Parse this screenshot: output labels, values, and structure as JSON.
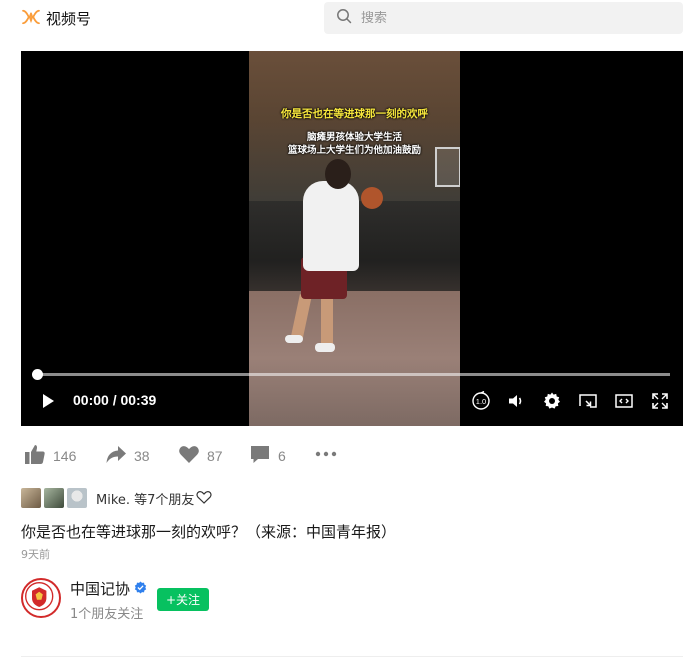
{
  "app": {
    "title": "视频号",
    "brand_color": "#fa9d3b"
  },
  "search": {
    "placeholder": "搜索"
  },
  "video": {
    "overlay_title": "你是否也在等进球那一刻的欢呼",
    "overlay_line1": "脑瘫男孩体验大学生活",
    "overlay_line2": "篮球场上大学生们为他加油鼓励",
    "current_time": "00:00",
    "duration": "00:39",
    "time_display": "00:00 / 00:39",
    "progress": 0.0,
    "speed_icon_text": "1.0"
  },
  "actions": {
    "like_count": "146",
    "share_count": "38",
    "favorite_count": "87",
    "comment_count": "6"
  },
  "friends": {
    "text": "Mike. 等7个朋友"
  },
  "post": {
    "description": "你是否也在等进球那一刻的欢呼？（来源：中国青年报）",
    "time_ago": "9天前"
  },
  "author": {
    "name": "中国记协",
    "followers_text": "1个朋友关注",
    "follow_label": "+关注",
    "accent_color": "#07c160"
  },
  "icons": {
    "logo": "channels-logo-icon",
    "search": "search-icon",
    "play": "play-icon",
    "speed": "playback-speed-icon",
    "volume": "volume-icon",
    "settings": "gear-icon",
    "cast": "cast-icon",
    "pip": "picture-in-picture-icon",
    "fullscreen": "fullscreen-icon",
    "like": "thumbs-up-icon",
    "share": "share-icon",
    "favorite": "heart-icon",
    "comment": "comment-icon",
    "more": "more-icon"
  }
}
